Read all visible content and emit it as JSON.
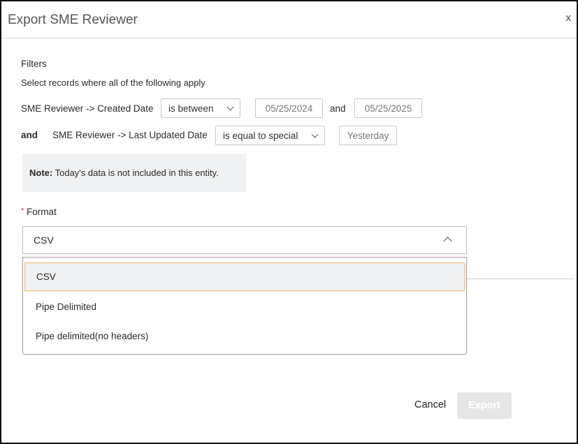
{
  "dialog": {
    "title": "Export SME Reviewer",
    "close_label": "x"
  },
  "filters": {
    "heading": "Filters",
    "subheading": "Select records where all of the following apply",
    "rows": [
      {
        "prefix": "",
        "field": "SME Reviewer -> Created Date",
        "operator": "is between",
        "value_from": "05/25/2024",
        "joiner": "and",
        "value_to": "05/25/2025"
      },
      {
        "prefix": "and",
        "field": "SME Reviewer -> Last Updated Date",
        "operator": "is equal to special",
        "value": "Yesterday"
      }
    ]
  },
  "note": {
    "label": "Note:",
    "text": "Today's data is not included in this entity."
  },
  "format": {
    "required_mark": "*",
    "label": "Format",
    "selected": "CSV",
    "options": [
      "CSV",
      "Pipe Delimited",
      "Pipe delimited(no headers)"
    ]
  },
  "footer": {
    "cancel_label": "Cancel",
    "export_label": "Export"
  },
  "colors": {
    "selected_option_border": "#f0b86a",
    "selected_option_bg": "#f0f1f3",
    "required": "#d9342b",
    "export_disabled_bg": "#e6e6e6"
  }
}
